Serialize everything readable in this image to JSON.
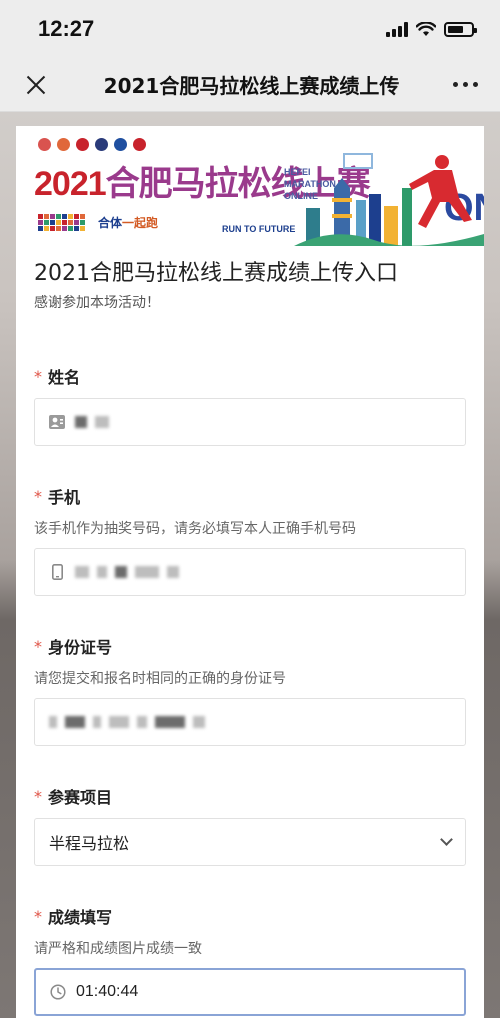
{
  "status_bar": {
    "time": "12:27"
  },
  "nav": {
    "title": "2021合肥马拉松线上赛成绩上传"
  },
  "banner": {
    "title_year": "2021",
    "title_cn": "合肥马拉松线上赛",
    "en_line1": "HEFEI",
    "en_line2": "MARATHON",
    "en_line3": "ONLINE",
    "slogan_a": "合体",
    "slogan_b": "一起跑",
    "run_to_future": "RUN TO FUTURE",
    "logo_colors": [
      "#d9534f",
      "#e0683a",
      "#c8232c",
      "#2a3b7a",
      "#1f4fa0",
      "#c8232c"
    ],
    "skyline_word": "ON"
  },
  "form": {
    "title": "2021合肥马拉松线上赛成绩上传入口",
    "description": "感谢参加本场活动！",
    "required_mark": "*",
    "fields": {
      "name": {
        "label": "姓名"
      },
      "phone": {
        "label": "手机",
        "hint": "该手机作为抽奖号码，请务必填写本人正确手机号码"
      },
      "id_number": {
        "label": "身份证号",
        "hint": "请您提交和报名时相同的正确的身份证号"
      },
      "event": {
        "label": "参赛项目",
        "value": "半程马拉松"
      },
      "result": {
        "label": "成绩填写",
        "hint": "请严格和成绩图片成绩一致",
        "value": "01:40:44"
      }
    }
  },
  "colors": {
    "required": "#e05548",
    "focus_border": "#8aa4d6",
    "brand_red": "#c8232c",
    "brand_purple": "#9a3a8c"
  }
}
